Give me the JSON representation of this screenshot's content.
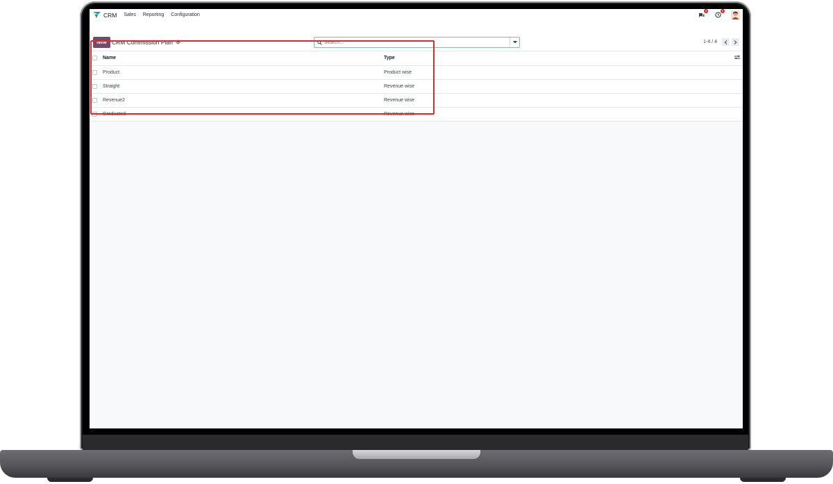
{
  "navbar": {
    "app_name": "CRM",
    "menu": [
      "Sales",
      "Reporting",
      "Configuration"
    ],
    "messages_badge": "6",
    "activities_badge": "8"
  },
  "control": {
    "new_label": "New",
    "title": "CRM Commission Plan",
    "search_placeholder": "Search...",
    "pager": "1-4 / 4"
  },
  "table": {
    "headers": {
      "name": "Name",
      "type": "Type"
    },
    "rows": [
      {
        "name": "Product",
        "type": "Product wise"
      },
      {
        "name": "Straight",
        "type": "Revenue wise"
      },
      {
        "name": "Revenue2",
        "type": "Revenue wise"
      },
      {
        "name": "Graduated",
        "type": "Revenue wise"
      }
    ]
  },
  "colors": {
    "brand": "#714b67",
    "highlight": "#e0262f",
    "badge": "#e02424"
  },
  "icons": {
    "app": "crm-logo-icon",
    "messages": "chat-icon",
    "activities": "clock-icon",
    "settings": "gear-icon",
    "search": "search-icon",
    "dropdown": "caret-down-icon",
    "prev": "chevron-left-icon",
    "next": "chevron-right-icon",
    "optional_columns": "sliders-icon"
  }
}
